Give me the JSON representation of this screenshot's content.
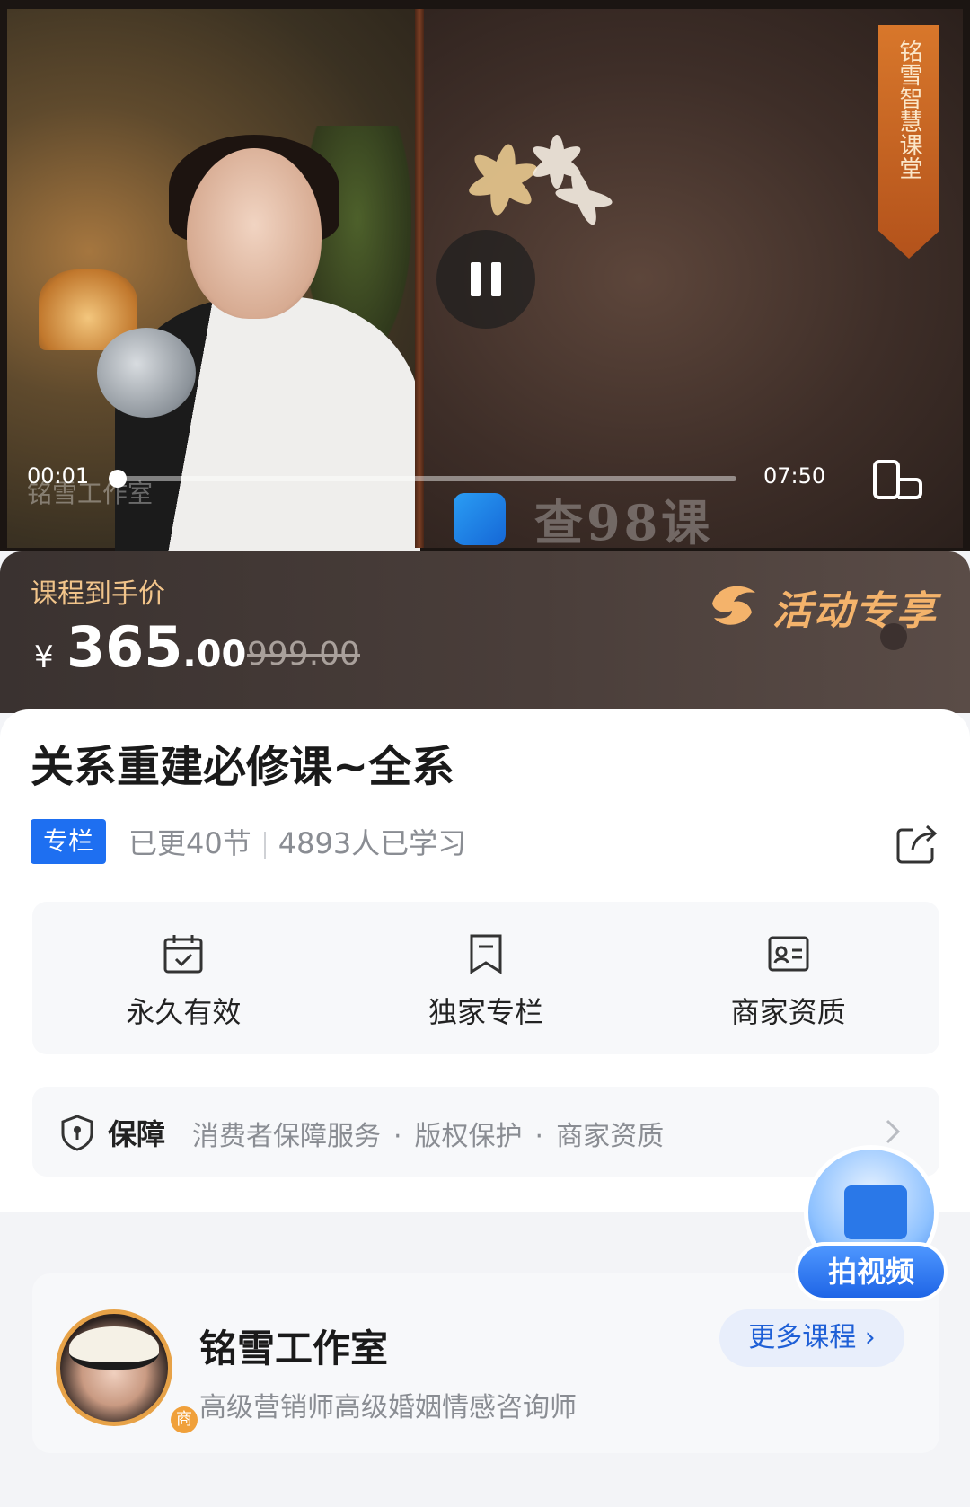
{
  "video": {
    "banner_text": "铭雪智慧课堂",
    "current_time": "00:01",
    "total_time": "07:50",
    "progress": 0.002,
    "watermark_left": "铭雪工作室",
    "watermark_brand": "查98课"
  },
  "price": {
    "label": "课程到手价",
    "currency": "¥",
    "price_int": "365",
    "price_dec": ".00",
    "original": "999.00",
    "activity": "活动专享"
  },
  "course": {
    "title": "关系重建必修课~全系",
    "tag": "专栏",
    "updated": "已更40节",
    "learners": "4893人已学习"
  },
  "features": [
    {
      "label": "永久有效",
      "icon": "calendar-check-icon"
    },
    {
      "label": "独家专栏",
      "icon": "bookmark-icon"
    },
    {
      "label": "商家资质",
      "icon": "id-card-icon"
    }
  ],
  "guarantee": {
    "label": "保障",
    "items": [
      "消费者保障服务",
      "版权保护",
      "商家资质"
    ],
    "separator": "·"
  },
  "author": {
    "name": "铭雪工作室",
    "desc": "高级营销师高级婚姻情感咨询师",
    "badge": "商",
    "more": "更多课程"
  },
  "float_button": {
    "label": "拍视频"
  },
  "colors": {
    "accent_blue": "#1e6ff1",
    "price_label": "#f1c48a",
    "activity": "#f4b36b"
  }
}
